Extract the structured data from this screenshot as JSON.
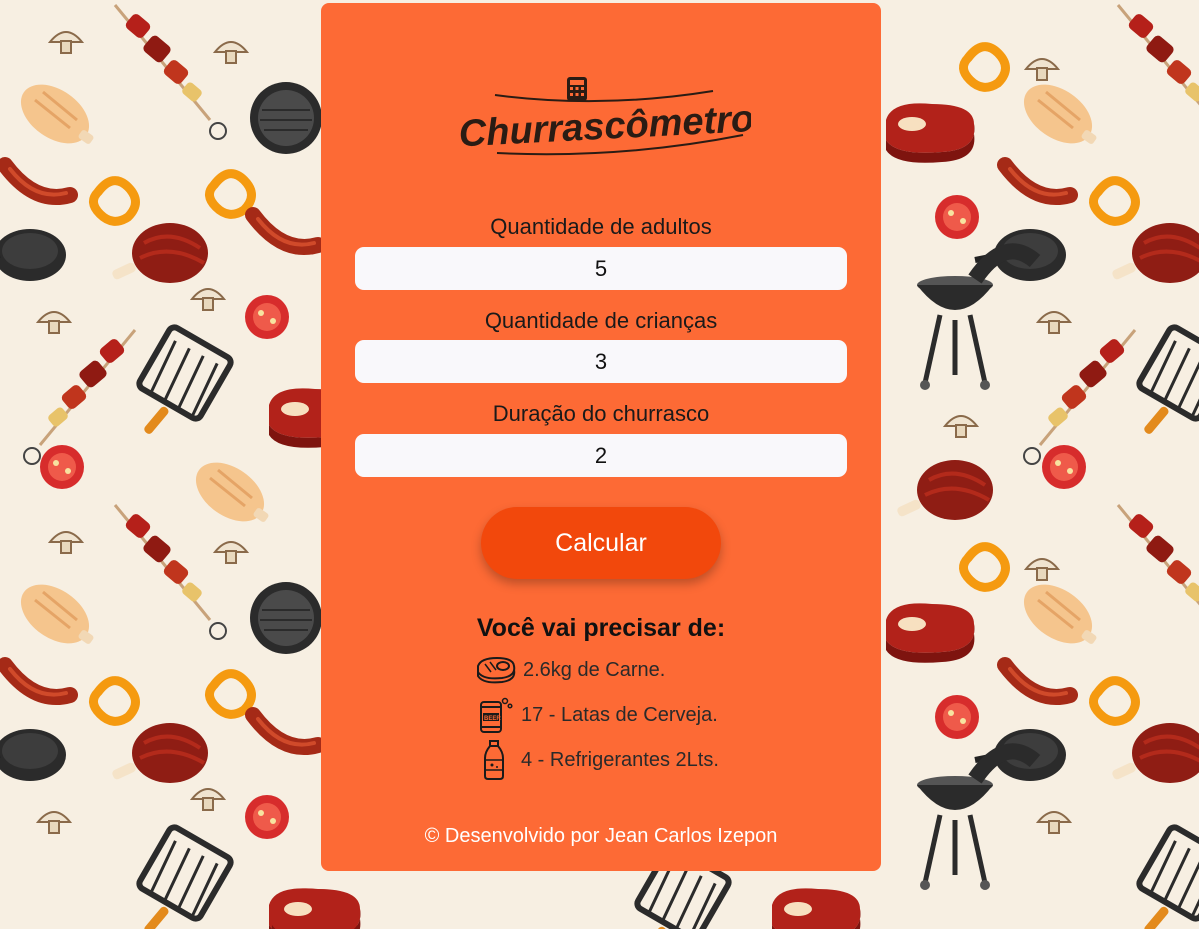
{
  "app": {
    "logo_text": "Churrascômetro",
    "accent": "#fd6a35",
    "button_color": "#f2480c",
    "background": "#f7efe2"
  },
  "form": {
    "adults_label": "Quantidade de adultos",
    "adults_value": "5",
    "children_label": "Quantidade de crianças",
    "children_value": "3",
    "duration_label": "Duração do churrasco",
    "duration_value": "2",
    "submit_label": "Calcular"
  },
  "results": {
    "title": "Você vai precisar de:",
    "items": [
      {
        "icon": "meat-icon",
        "text": "2.6kg de Carne."
      },
      {
        "icon": "beer-can-icon",
        "text": "17 - Latas de Cerveja."
      },
      {
        "icon": "soda-bottle-icon",
        "text": "4 - Refrigerantes 2Lts."
      }
    ]
  },
  "footer": {
    "credit": "© Desenvolvido por Jean Carlos Izepon"
  }
}
